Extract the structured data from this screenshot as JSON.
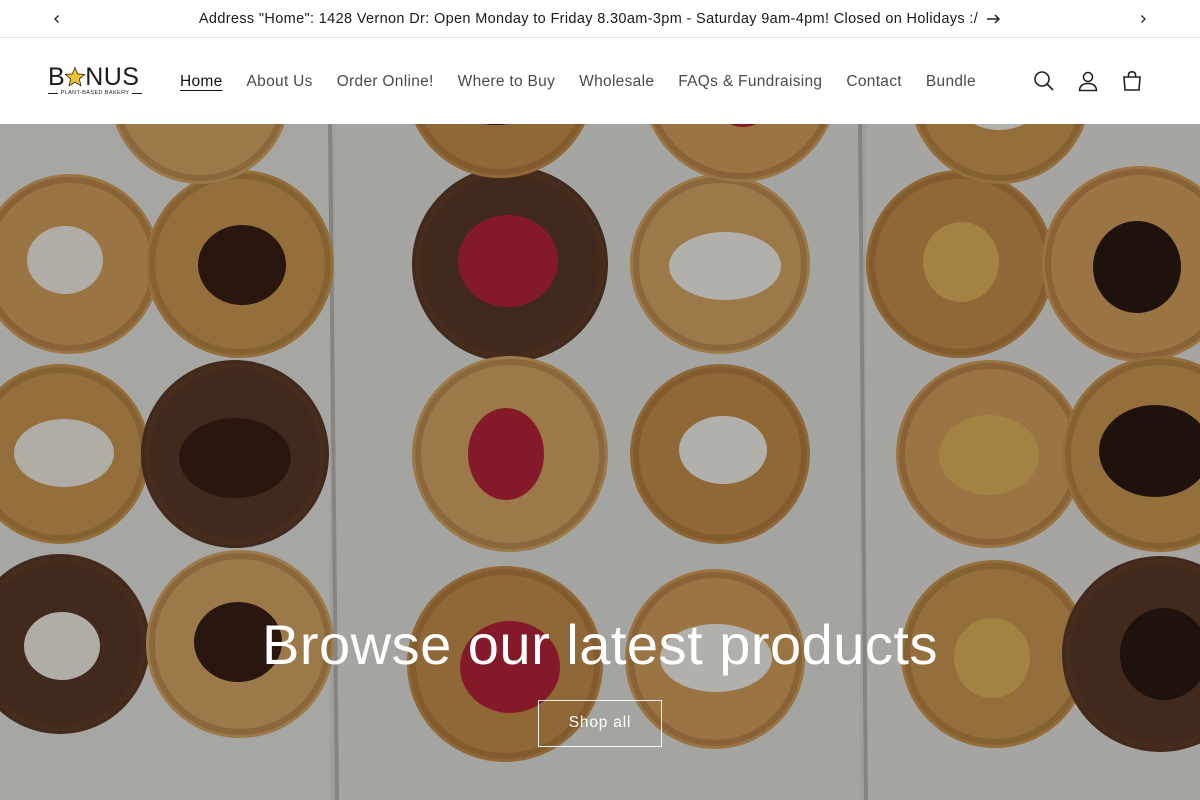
{
  "announcement": {
    "text": "Address \"Home\": 1428 Vernon Dr: Open Monday to Friday 8.30am-3pm - Saturday 9am-4pm! Closed on Holidays :/",
    "prev_icon": "chevron-left-icon",
    "next_icon": "chevron-right-icon",
    "link_icon": "arrow-right-icon"
  },
  "logo": {
    "text_left": "B",
    "text_right": "NUS",
    "tagline": "PLANT-BASED BAKERY",
    "star_color": "#f2c230"
  },
  "nav": {
    "items": [
      {
        "label": "Home",
        "active": true
      },
      {
        "label": "About Us"
      },
      {
        "label": "Order Online!"
      },
      {
        "label": "Where to Buy"
      },
      {
        "label": "Wholesale"
      },
      {
        "label": "FAQs & Fundraising"
      },
      {
        "label": "Contact"
      },
      {
        "label": "Bundle"
      }
    ]
  },
  "header_icons": [
    "search-icon",
    "account-icon",
    "cart-icon"
  ],
  "hero": {
    "title": "Browse our latest products",
    "button_label": "Shop all",
    "image": "box-of-assorted-cookies"
  }
}
